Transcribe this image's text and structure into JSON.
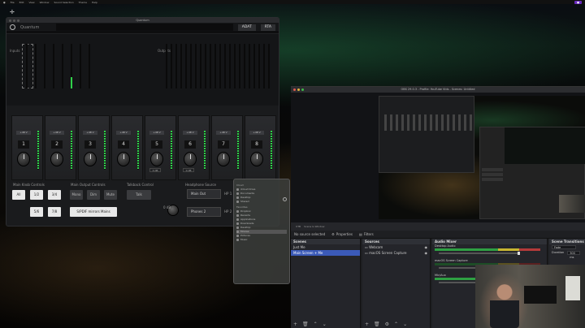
{
  "menubar": {
    "items": [
      "File",
      "Edit",
      "View",
      "Window",
      "Sound Selection",
      "Theme",
      "Help"
    ]
  },
  "uc": {
    "window_title": "Quantum",
    "model": "Quantum",
    "adat_button": "ADAT",
    "rta_button": "RTA",
    "inputs_label": "Inputs",
    "outputs_label": "Outputs",
    "phantom_label": "+48 V",
    "channels": [
      "1",
      "2",
      "3",
      "4",
      "5",
      "6",
      "7",
      "8"
    ],
    "gain_db": "0 dB",
    "main_knob_db": "0 dB",
    "main_knob_label": "Main Knob Controls",
    "main_output_label": "Main Output Controls",
    "talkback_label": "Talkback Control",
    "headphone_label": "Headphone Source",
    "btn_all": "All",
    "btn_12": "1/2",
    "btn_34": "3/4",
    "btn_56": "5/6",
    "btn_78": "7/8",
    "btn_mono": "Mono",
    "btn_dim": "Dim",
    "btn_mute": "Mute",
    "btn_talk": "Talk",
    "btn_spdif": "S/PDIF mirrors Mains",
    "hp_main_out": "Main Out",
    "hp_phones": "Phones 2",
    "hp1_label": "HP 1",
    "hp2_label": "HP 2"
  },
  "finder": {
    "sections": [
      {
        "header": "Cloud",
        "items": [
          "iCloud Drive",
          "Documents",
          "Desktop",
          "Shared"
        ]
      },
      {
        "header": "Favorites",
        "items": [
          "Dropbox",
          "Recents",
          "Applications",
          "Downloads",
          "Desktop",
          "Movies",
          "Pictures",
          "Music"
        ]
      }
    ]
  },
  "obs": {
    "title": "OBS 29.0.3 - Profile: YouTube Vids - Scenes: Untitled",
    "status_left": "UTB",
    "status_right": "Scene Is Window",
    "no_source": "No source selected",
    "properties": "Properties",
    "filters": "Filters",
    "scenes_header": "Scenes",
    "scenes": [
      "Just Me",
      "Main Screen + Me"
    ],
    "sources_header": "Sources",
    "sources": [
      "Webcam",
      "macOS Screen Capture"
    ],
    "mixer_header": "Audio Mixer",
    "mixer": [
      {
        "name": "Desktop Audio",
        "db": "0.0 dB"
      },
      {
        "name": "macOS Screen Capture",
        "db": "0.0 dB"
      },
      {
        "name": "Mic/Aux",
        "db": "0.0 dB"
      }
    ],
    "transitions_header": "Scene Transitions",
    "transition": "Fade",
    "duration_label": "Duration",
    "duration": "300 ms"
  },
  "colors": {
    "accent": "#3b5ab8",
    "meter_green": "#2fd14a"
  }
}
